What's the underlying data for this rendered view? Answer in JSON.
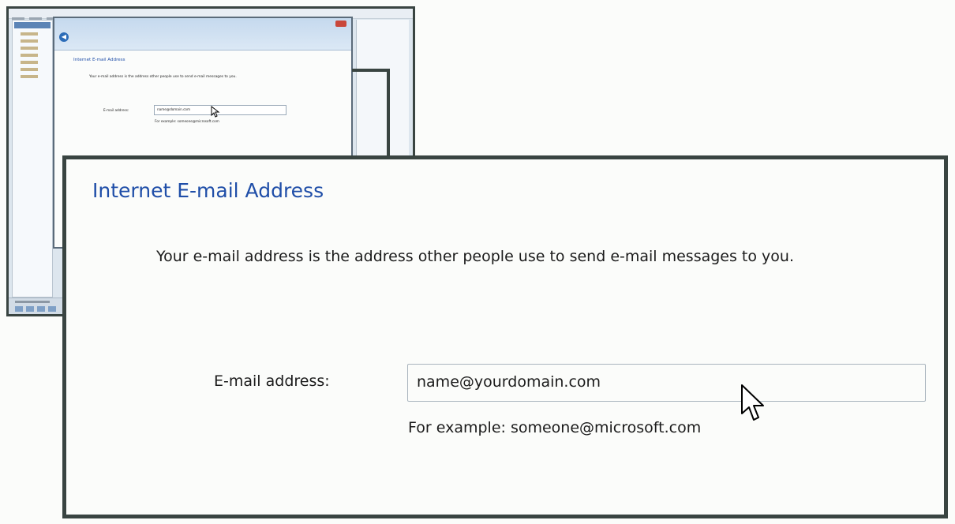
{
  "dialog": {
    "heading": "Internet E-mail Address",
    "intro": "Your e-mail address is the address other people use to send e-mail messages to you.",
    "email_label": "E-mail address:",
    "email_value": "name@yourdomain.com",
    "email_hint": "For example: someone@microsoft.com"
  },
  "thumbnail": {
    "heading": "Internet E-mail Address",
    "intro": "Your e-mail address is the address other people use to send e-mail messages to you.",
    "email_label": "E-mail address:",
    "email_value": "name@domain.com",
    "email_hint": "For example: someone@microsoft.com"
  },
  "colors": {
    "heading": "#1f4ea8",
    "frame": "#394441",
    "background": "#fbfcfa",
    "close_button": "#c9473a",
    "back_button": "#2c6cb8"
  },
  "icons": [
    "back-arrow-icon",
    "close-icon",
    "mouse-pointer-icon"
  ]
}
